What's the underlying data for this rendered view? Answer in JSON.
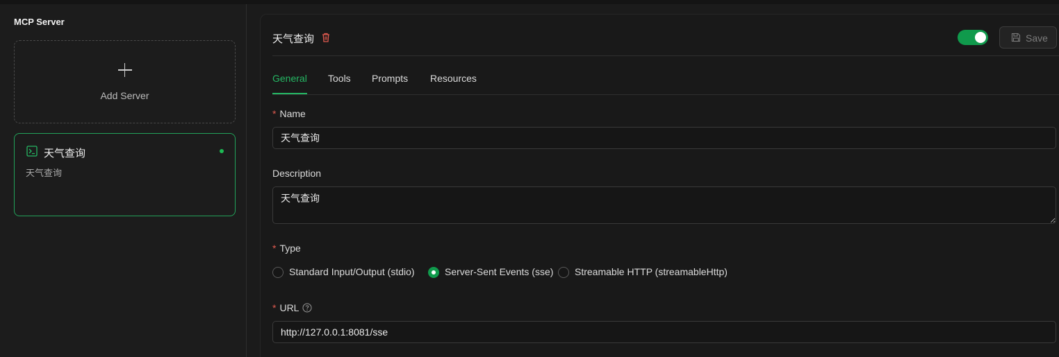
{
  "sidebar": {
    "title": "MCP Server",
    "add_label": "Add Server",
    "servers": [
      {
        "name": "天气查询",
        "description": "天气查询",
        "status_color": "#1db954"
      }
    ]
  },
  "header": {
    "title": "天气查询",
    "enabled": true,
    "save_label": "Save"
  },
  "tabs": [
    {
      "label": "General",
      "active": true
    },
    {
      "label": "Tools",
      "active": false
    },
    {
      "label": "Prompts",
      "active": false
    },
    {
      "label": "Resources",
      "active": false
    }
  ],
  "form": {
    "name": {
      "label": "Name",
      "required": true,
      "value": "天气查询"
    },
    "description": {
      "label": "Description",
      "value": "天气查询"
    },
    "type": {
      "label": "Type",
      "required": true,
      "options": [
        {
          "label": "Standard Input/Output (stdio)",
          "selected": false
        },
        {
          "label": "Server-Sent Events (sse)",
          "selected": true
        },
        {
          "label": "Streamable HTTP (streamableHttp)",
          "selected": false
        }
      ]
    },
    "url": {
      "label": "URL",
      "required": true,
      "value": "http://127.0.0.1:8081/sse"
    }
  },
  "colors": {
    "accent": "#25b864",
    "toggle_on": "#109a4c",
    "required": "#e05a4f",
    "danger": "#e05a4f"
  }
}
